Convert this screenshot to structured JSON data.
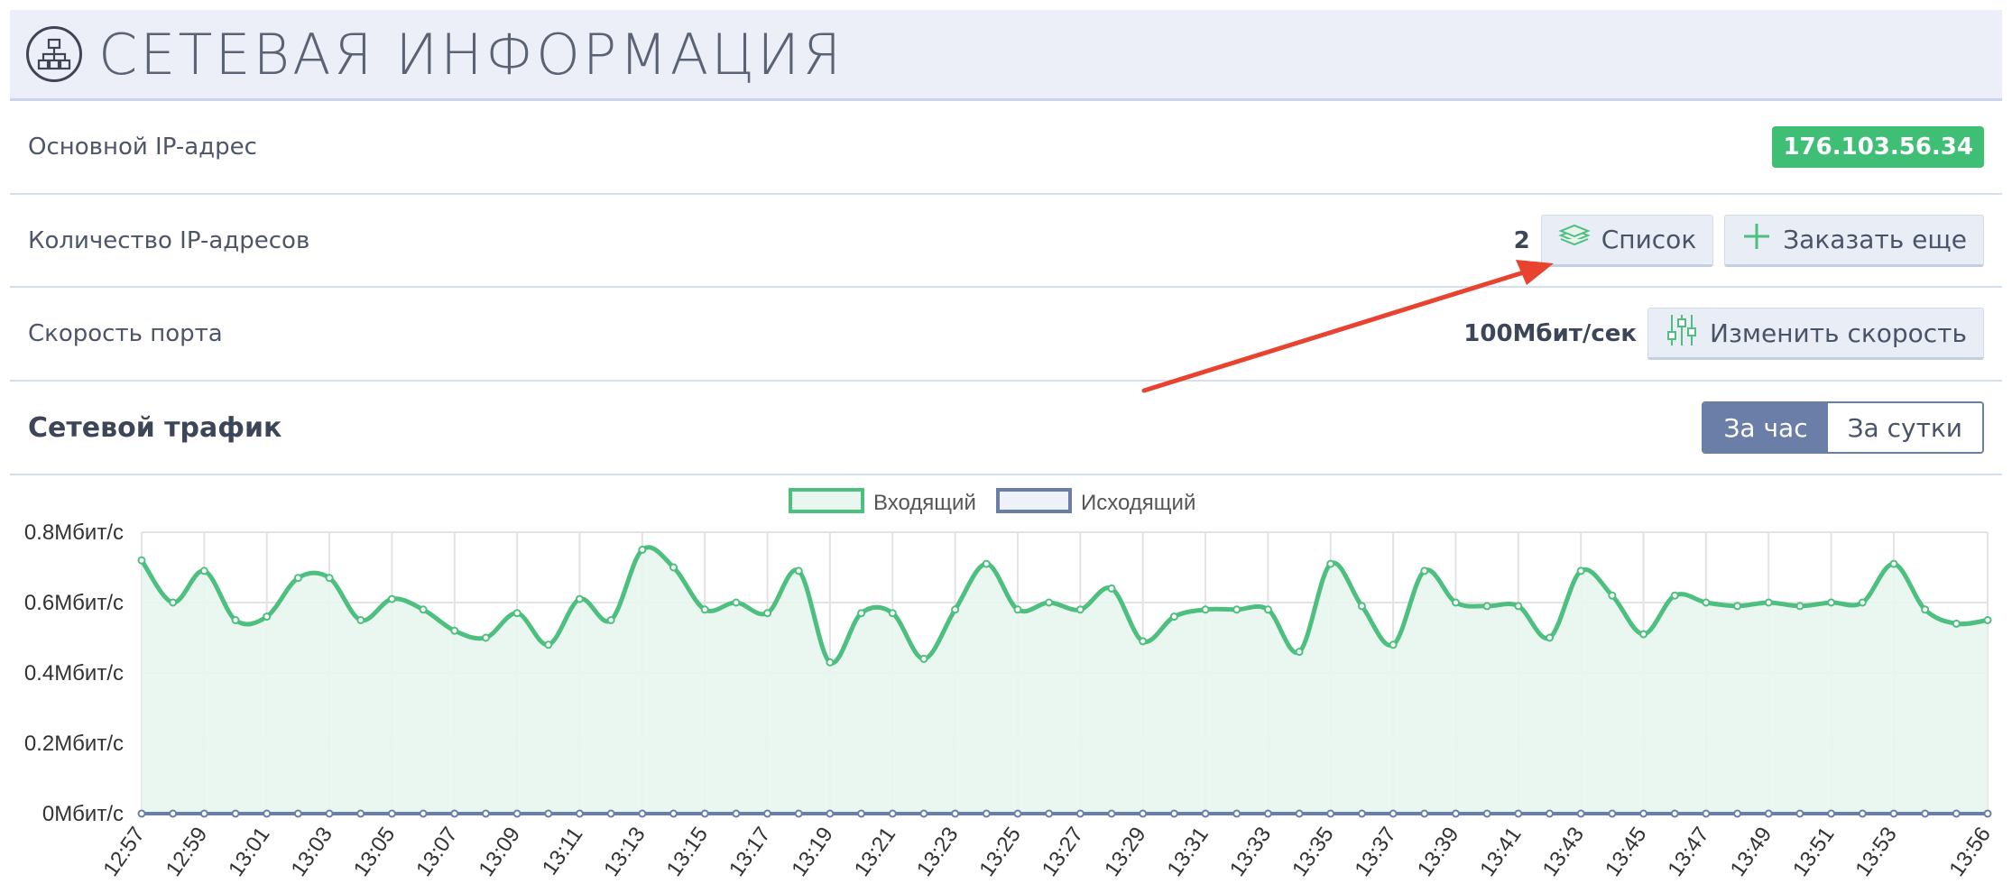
{
  "header": {
    "title": "СЕТЕВАЯ ИНФОРМАЦИЯ"
  },
  "rows": {
    "primary_ip": {
      "label": "Основной IP-адрес",
      "value": "176.103.56.34"
    },
    "ip_count": {
      "label": "Количество IP-адресов",
      "value": "2",
      "list_button": "Список",
      "order_button": "Заказать еще"
    },
    "port_speed": {
      "label": "Скорость порта",
      "value": "100Мбит/сек",
      "change_button": "Изменить скорость"
    }
  },
  "traffic": {
    "title": "Сетевой трафик",
    "toggle": {
      "hour": "За час",
      "day": "За сутки",
      "active": "hour"
    }
  },
  "chart_data": {
    "type": "line",
    "legend": [
      "Входящий",
      "Исходящий"
    ],
    "colors": {
      "incoming": "#4dbf7f",
      "outgoing": "#6a7ea8"
    },
    "y_ticks": [
      "0Мбит/с",
      "0.2Мбит/с",
      "0.4Мбит/с",
      "0.6Мбит/с",
      "0.8Мбит/с"
    ],
    "ylim": [
      0,
      0.8
    ],
    "x_tick_labels": [
      "12:57",
      "12:59",
      "13:01",
      "13:03",
      "13:05",
      "13:07",
      "13:09",
      "13:11",
      "13:13",
      "13:15",
      "13:17",
      "13:19",
      "13:21",
      "13:23",
      "13:25",
      "13:27",
      "13:29",
      "13:31",
      "13:33",
      "13:35",
      "13:37",
      "13:39",
      "13:41",
      "13:43",
      "13:45",
      "13:47",
      "13:49",
      "13:51",
      "13:53",
      "13:56"
    ],
    "x": [
      "12:57",
      "12:58",
      "12:59",
      "13:00",
      "13:01",
      "13:02",
      "13:03",
      "13:04",
      "13:05",
      "13:06",
      "13:07",
      "13:08",
      "13:09",
      "13:10",
      "13:11",
      "13:12",
      "13:13",
      "13:14",
      "13:15",
      "13:16",
      "13:17",
      "13:18",
      "13:19",
      "13:20",
      "13:21",
      "13:22",
      "13:23",
      "13:24",
      "13:25",
      "13:26",
      "13:27",
      "13:28",
      "13:29",
      "13:30",
      "13:31",
      "13:32",
      "13:33",
      "13:34",
      "13:35",
      "13:36",
      "13:37",
      "13:38",
      "13:39",
      "13:40",
      "13:41",
      "13:42",
      "13:43",
      "13:44",
      "13:45",
      "13:46",
      "13:47",
      "13:48",
      "13:49",
      "13:50",
      "13:51",
      "13:52",
      "13:53",
      "13:54",
      "13:55",
      "13:56"
    ],
    "series": [
      {
        "name": "Входящий",
        "values": [
          0.72,
          0.6,
          0.69,
          0.55,
          0.56,
          0.67,
          0.67,
          0.55,
          0.61,
          0.58,
          0.52,
          0.5,
          0.57,
          0.48,
          0.61,
          0.55,
          0.75,
          0.7,
          0.58,
          0.6,
          0.57,
          0.69,
          0.43,
          0.57,
          0.57,
          0.44,
          0.58,
          0.71,
          0.58,
          0.6,
          0.58,
          0.64,
          0.49,
          0.56,
          0.58,
          0.58,
          0.58,
          0.46,
          0.71,
          0.59,
          0.48,
          0.69,
          0.6,
          0.59,
          0.59,
          0.5,
          0.69,
          0.62,
          0.51,
          0.62,
          0.6,
          0.59,
          0.6,
          0.59,
          0.6,
          0.6,
          0.71,
          0.58,
          0.54,
          0.55
        ]
      },
      {
        "name": "Исходящий",
        "values": [
          0,
          0,
          0,
          0,
          0,
          0,
          0,
          0,
          0,
          0,
          0,
          0,
          0,
          0,
          0,
          0,
          0,
          0,
          0,
          0,
          0,
          0,
          0,
          0,
          0,
          0,
          0,
          0,
          0,
          0,
          0,
          0,
          0,
          0,
          0,
          0,
          0,
          0,
          0,
          0,
          0,
          0,
          0,
          0,
          0,
          0,
          0,
          0,
          0,
          0,
          0,
          0,
          0,
          0,
          0,
          0,
          0,
          0,
          0,
          0
        ]
      }
    ]
  }
}
